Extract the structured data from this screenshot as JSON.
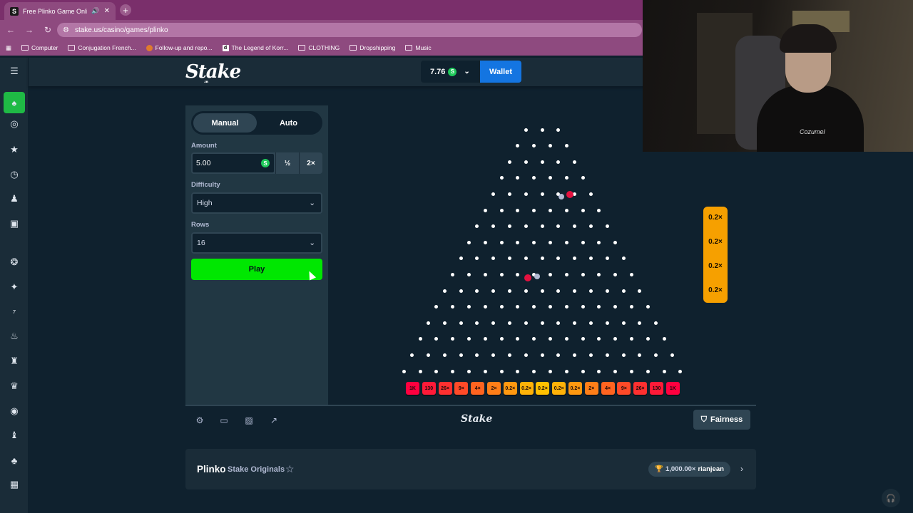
{
  "browser": {
    "tab_title": "Free Plinko Game Online - ",
    "tab_favicon": "S",
    "url": "stake.us/casino/games/plinko",
    "bookmarks": [
      {
        "label": "Computer",
        "icon": "folder-icon"
      },
      {
        "label": "Conjugation French...",
        "icon": "site-icon"
      },
      {
        "label": "Follow-up and repo...",
        "icon": "site-icon"
      },
      {
        "label": "The Legend of Korr...",
        "icon": "site-icon"
      },
      {
        "label": "CLOTHING",
        "icon": "folder-icon"
      },
      {
        "label": "Dropshipping",
        "icon": "folder-icon"
      },
      {
        "label": "Music",
        "icon": "folder-icon"
      }
    ]
  },
  "header": {
    "logo": "Stake",
    "logo_sub": ".us",
    "balance": "7.76",
    "coin_symbol": "S",
    "wallet_label": "Wallet"
  },
  "panel": {
    "tabs": [
      "Manual",
      "Auto"
    ],
    "active_tab": "Manual",
    "amount_label": "Amount",
    "amount_value": "5.00",
    "half_label": "½",
    "double_label": "2×",
    "difficulty_label": "Difficulty",
    "difficulty_value": "High",
    "rows_label": "Rows",
    "rows_value": "16",
    "play_label": "Play"
  },
  "board": {
    "rows": 16,
    "multipliers": [
      "1K",
      "130",
      "26×",
      "9×",
      "4×",
      "2×",
      "0.2×",
      "0.2×",
      "0.2×",
      "0.2×",
      "0.2×",
      "2×",
      "4×",
      "9×",
      "26×",
      "130",
      "1K"
    ],
    "history": [
      "0.2×",
      "0.2×",
      "0.2×",
      "0.2×"
    ]
  },
  "footer": {
    "logo": "Stake",
    "fairness_label": "Fairness"
  },
  "info": {
    "title": "Plinko",
    "subtitle": "Stake Originals",
    "record_value": "1,000.00×",
    "record_user": "rianjean"
  },
  "webcam": {
    "shirt_text": "Cozumel"
  },
  "colors": {
    "accent_green": "#00e701",
    "wallet_blue": "#1475e1",
    "ball_red": "#e3113f",
    "history_orange": "#f6a000",
    "browser_purple": "#8e4a7f"
  }
}
